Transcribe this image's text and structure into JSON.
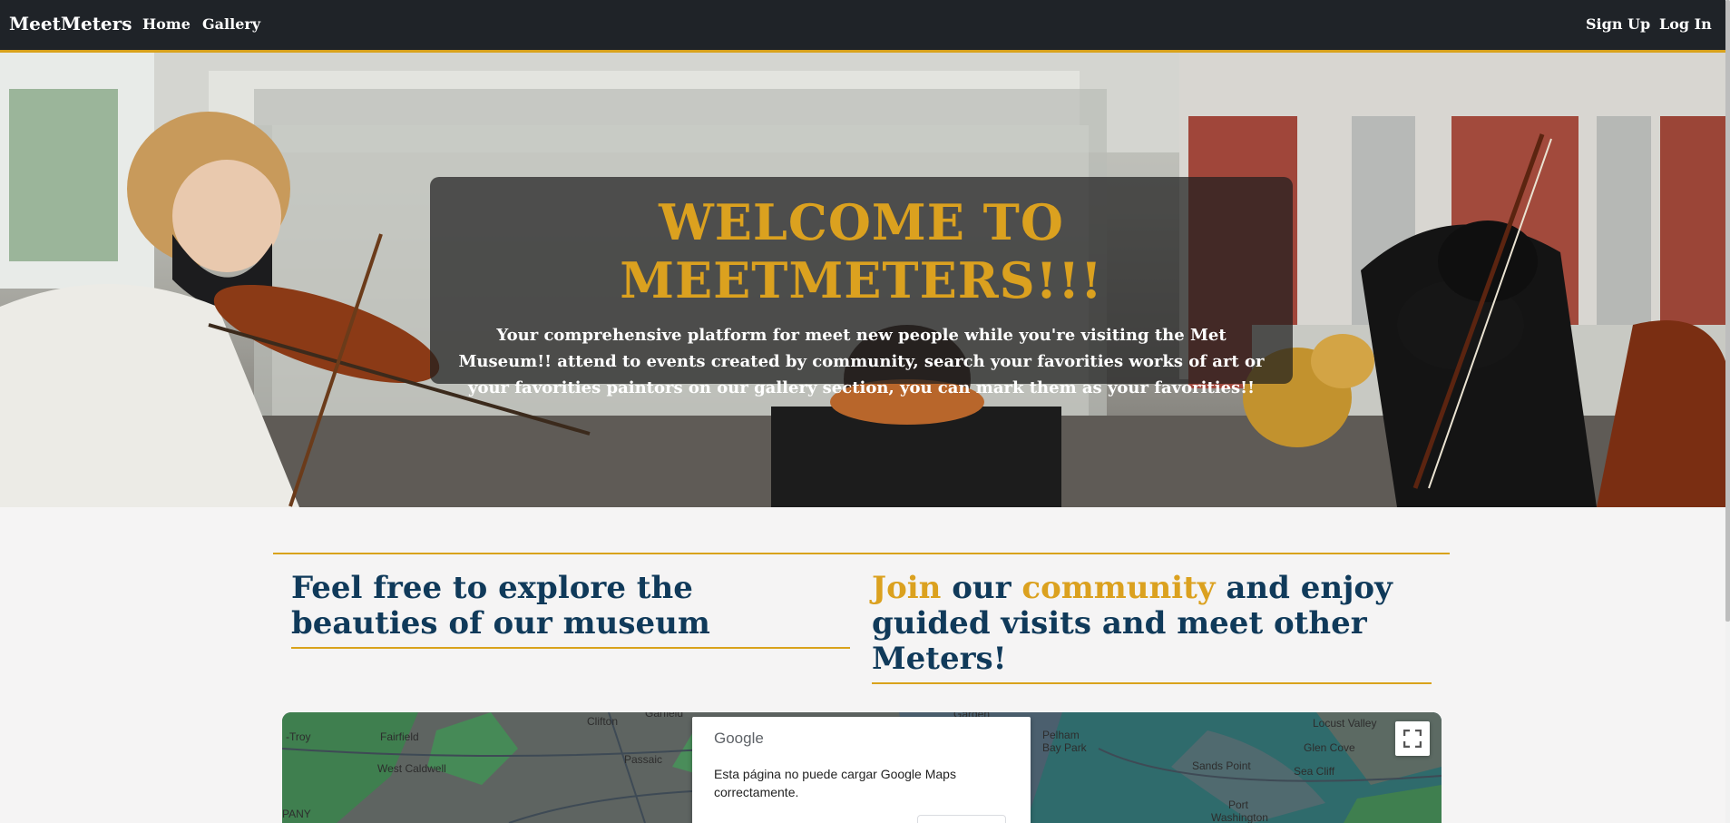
{
  "navbar": {
    "brand": "MeetMeters",
    "links": {
      "home": "Home",
      "gallery": "Gallery"
    },
    "auth": {
      "signup": "Sign Up",
      "login": "Log In"
    }
  },
  "hero": {
    "title": "WELCOME TO MEETMETERS!!!",
    "text": "Your comprehensive platform for meet new people while you're visiting the Met Museum!! attend to events created by community, search your favorities works of art or your favorities paintors on our gallery section, you can mark them as your favorities!!"
  },
  "features": {
    "left": "Feel free to explore the beauties of our museum",
    "right": {
      "word1": "Join",
      "word2": " our ",
      "word3": "community",
      "word4": " and enjoy guided visits and meet other Meters!"
    }
  },
  "map": {
    "labels": {
      "troy": "-Troy",
      "fairfield": "Fairfield",
      "west_caldwell": "West Caldwell",
      "clifton": "Clifton",
      "garfield": "Garfield",
      "passaic": "Passaic",
      "pelham_bay_park": "Pelham Bay Park",
      "sands_point": "Sands Point",
      "locust_valley": "Locust Valley",
      "glen_cove": "Glen Cove",
      "sea_cliff": "Sea Cliff",
      "port_washington": "Port Washington",
      "garden": "Garden",
      "pany": "PANY"
    },
    "dialog": {
      "logo": "Google",
      "message": "Esta página no puede cargar Google Maps correctamente."
    }
  },
  "colors": {
    "navbar_bg": "#1f2328",
    "accent_gold": "#dba11f",
    "heading_navy": "#103a5a",
    "page_bg": "#f5f4f4"
  }
}
